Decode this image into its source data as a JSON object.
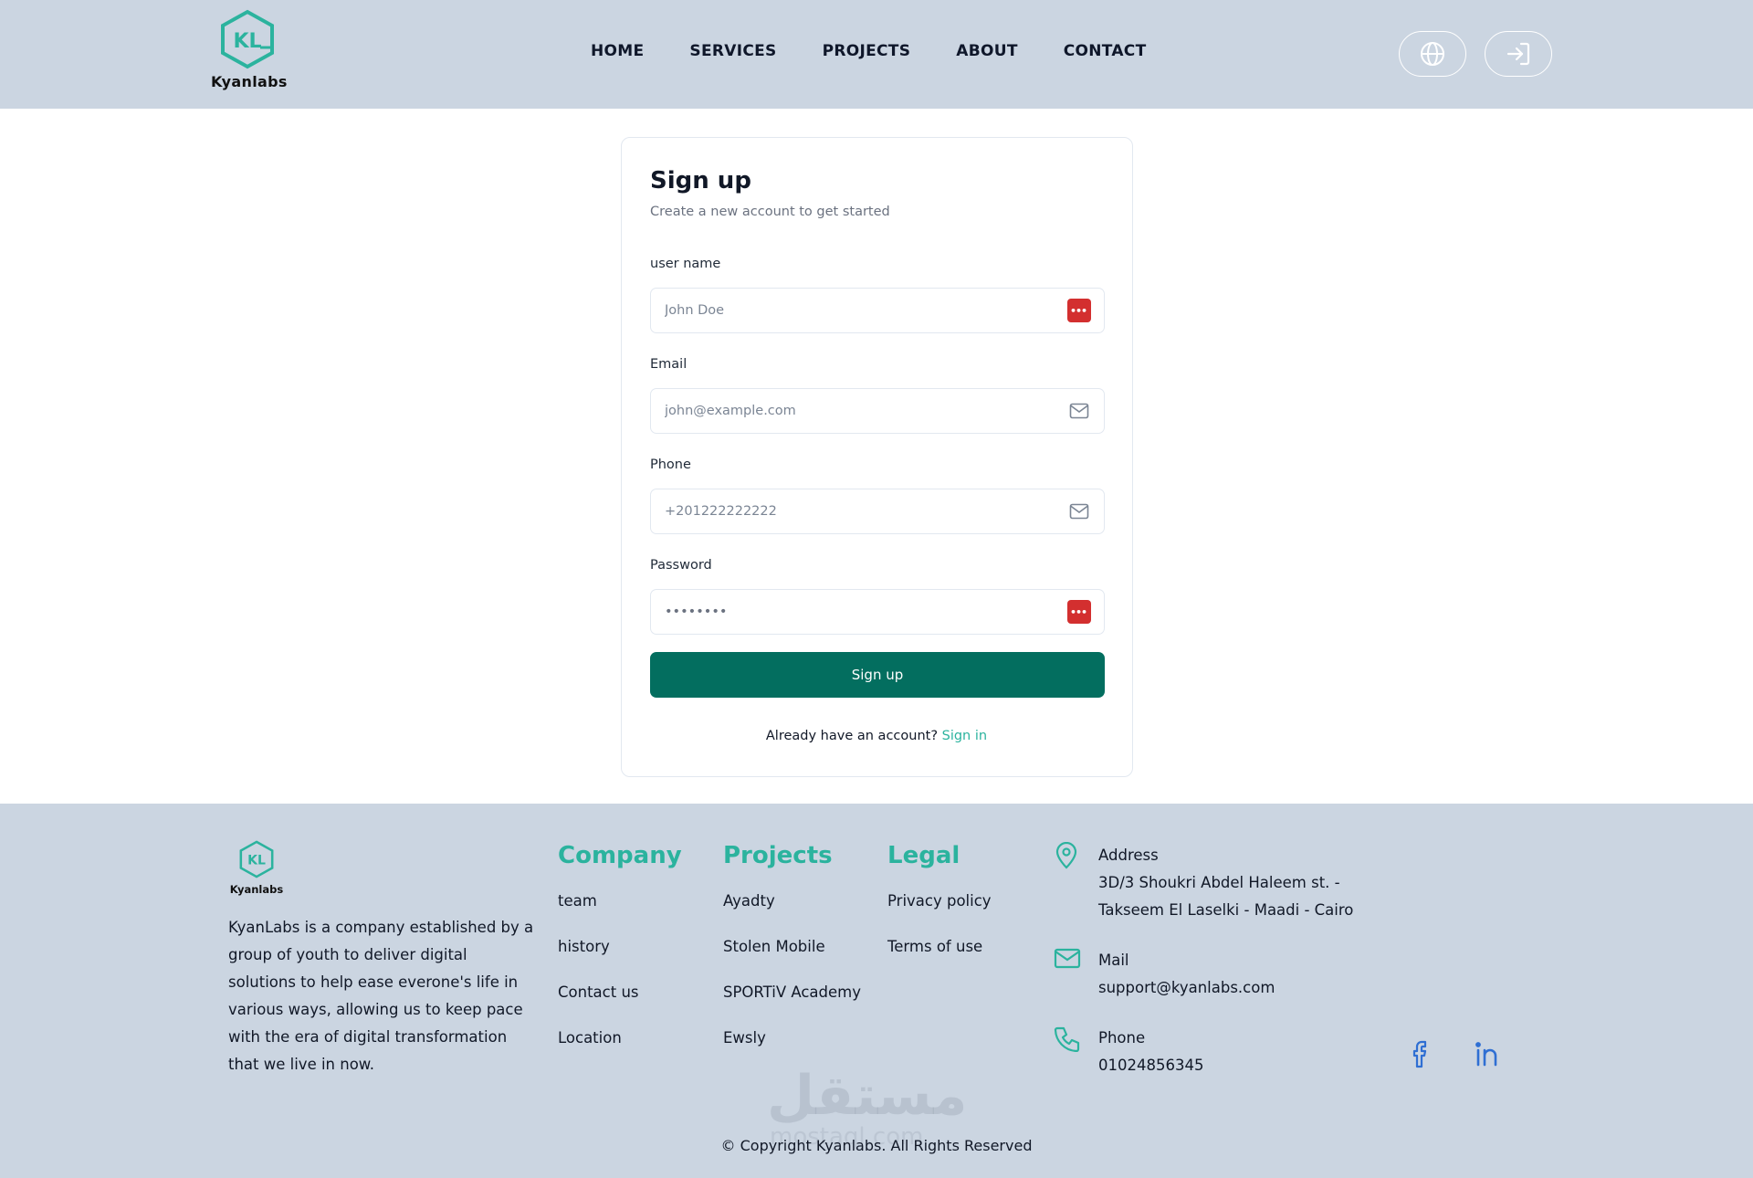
{
  "brand": {
    "name": "Kyanlabs",
    "monogram": "KL",
    "accent": "#2bb39e",
    "primary": "#036e5f"
  },
  "nav": {
    "items": [
      {
        "label": "HOME"
      },
      {
        "label": "SERVICES"
      },
      {
        "label": "PROJECTS"
      },
      {
        "label": "ABOUT"
      },
      {
        "label": "CONTACT"
      }
    ],
    "language_icon": "globe-icon",
    "login_icon": "sign-in-icon"
  },
  "form": {
    "title": "Sign up",
    "subtitle": "Create a new account to get started",
    "username": {
      "label": "user name",
      "placeholder": "John Doe"
    },
    "email": {
      "label": "Email",
      "placeholder": "john@example.com"
    },
    "phone": {
      "label": "Phone",
      "placeholder": "+201222222222"
    },
    "password": {
      "label": "Password",
      "value": "********"
    },
    "submit_label": "Sign up",
    "already_text": "Already have an account?",
    "signin_label": "Sign in"
  },
  "footer": {
    "logo_text": "Kyanlabs",
    "description": "KyanLabs is a company established by a group of youth to deliver digital solutions to help ease everone's life in various ways, allowing us to keep pace with the era of digital transformation that we live in now.",
    "company": {
      "title": "Company",
      "links": [
        "team",
        "history",
        "Contact us",
        "Location"
      ]
    },
    "projects": {
      "title": "Projects",
      "links": [
        "Ayadty",
        "Stolen Mobile",
        "SPORTiV Academy",
        "Ewsly"
      ]
    },
    "legal": {
      "title": "Legal",
      "links": [
        "Privacy policy",
        "Terms of use"
      ]
    },
    "address": {
      "label": "Address",
      "line1": "3D/3 Shoukri Abdel Haleem st. -",
      "line2": "Takseem El Laselki - Maadi - Cairo"
    },
    "mail": {
      "label": "Mail",
      "value": "support@kyanlabs.com"
    },
    "phone": {
      "label": "Phone",
      "value": "01024856345"
    },
    "copyright": "© Copyright Kyanlabs. All Rights Reserved",
    "watermark": "مستقل",
    "watermark_sub": "mostaql.com"
  }
}
